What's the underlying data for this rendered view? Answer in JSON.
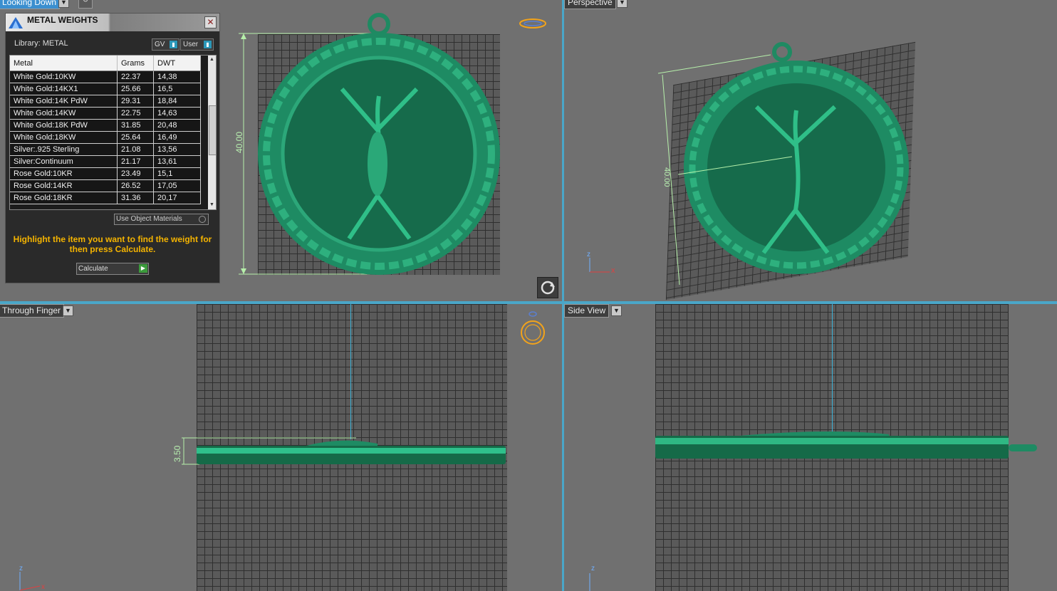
{
  "viewports": {
    "top_left": {
      "label": "Looking Down"
    },
    "top_right": {
      "label": "Perspective"
    },
    "bottom_left": {
      "label": "Through Finger"
    },
    "bottom_right": {
      "label": "Side View"
    }
  },
  "dimensions": {
    "height_label": "40.00",
    "perspective_label": "40.00",
    "thickness_label": "3.50"
  },
  "axes": {
    "x": "x",
    "z": "z"
  },
  "dialog": {
    "title": "METAL WEIGHTS",
    "library": "Library: METAL",
    "gv_label": "GV",
    "user_label": "User",
    "columns": [
      "Metal",
      "Grams",
      "DWT"
    ],
    "rows": [
      [
        "White Gold:10KW",
        "22.37",
        "14,38"
      ],
      [
        "White Gold:14KX1",
        "25.66",
        "16,5"
      ],
      [
        "White Gold:14K PdW",
        "29.31",
        "18,84"
      ],
      [
        "White Gold:14KW",
        "22.75",
        "14,63"
      ],
      [
        "White Gold:18K PdW",
        "31.85",
        "20,48"
      ],
      [
        "White Gold:18KW",
        "25.64",
        "16,49"
      ],
      [
        "Silver:.925 Sterling",
        "21.08",
        "13,56"
      ],
      [
        "Silver:Continuum",
        "21.17",
        "13,61"
      ],
      [
        "Rose Gold:10KR",
        "23.49",
        "15,1"
      ],
      [
        "Rose Gold:14KR",
        "26.52",
        "17,05"
      ],
      [
        "Rose Gold:18KR",
        "31.36",
        "20,17"
      ]
    ],
    "use_object_materials": "Use Object Materials",
    "hint": "Highlight the item you want to find the weight for then press Calculate.",
    "calculate_label": "Calculate"
  },
  "colors": {
    "model": "#1f8a62",
    "accent": "#4aa6c8",
    "hint": "#f5b400"
  }
}
